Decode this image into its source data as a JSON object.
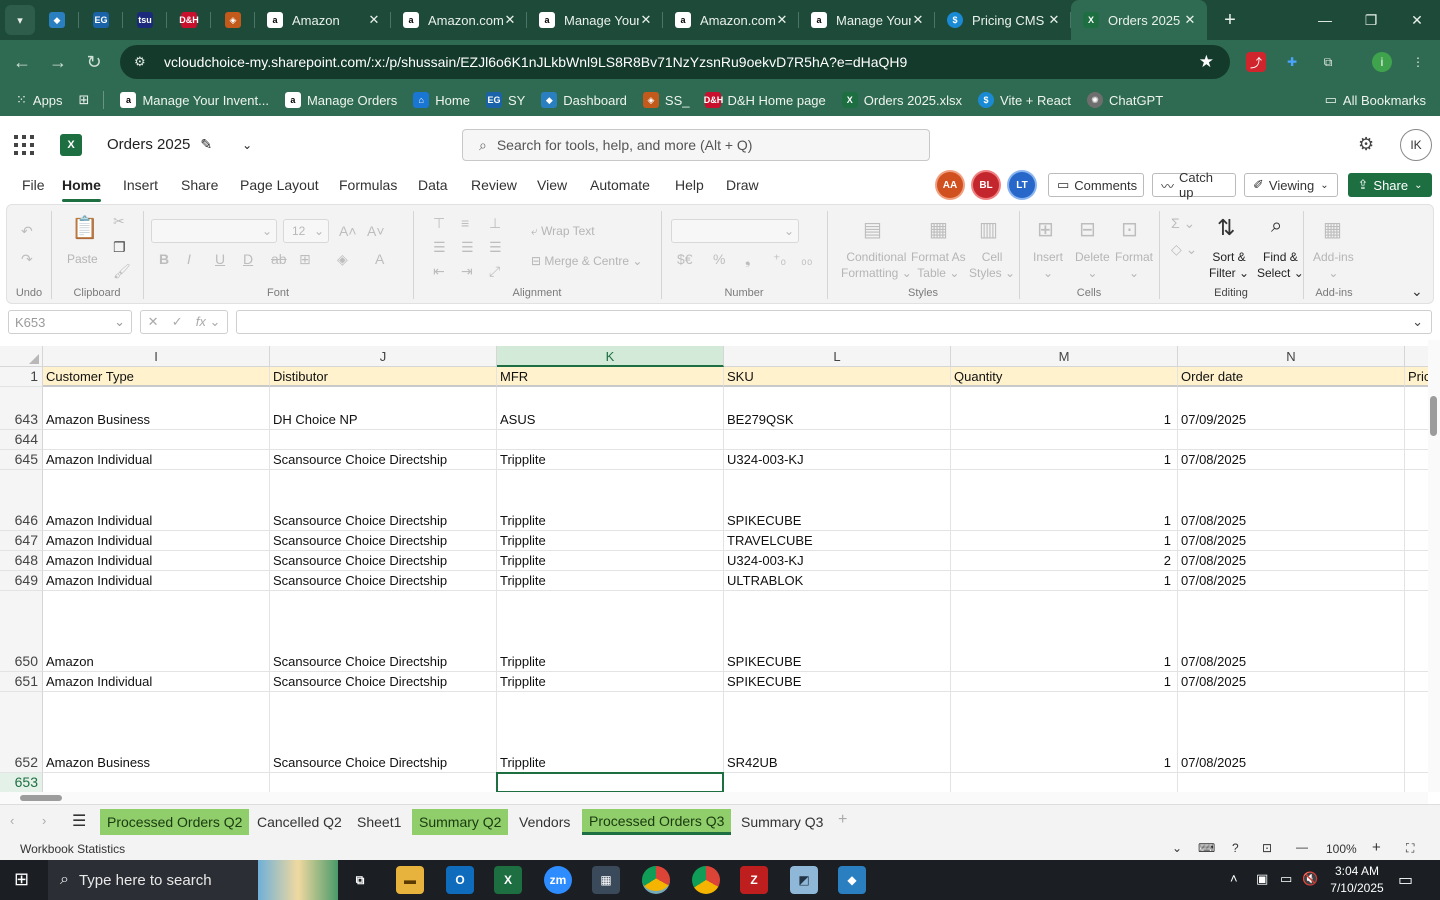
{
  "browser": {
    "tabs": [
      {
        "label": "Amazon",
        "icon": "amazon-icon"
      },
      {
        "label": "Amazon.com",
        "icon": "amazon-icon"
      },
      {
        "label": "Manage Your",
        "icon": "amazon-icon"
      },
      {
        "label": "Amazon.com",
        "icon": "amazon-icon"
      },
      {
        "label": "Manage Your",
        "icon": "amazon-icon"
      },
      {
        "label": "Pricing CMS",
        "icon": "dollar-icon"
      },
      {
        "label": "Orders 2025",
        "icon": "excel-icon",
        "active": true
      }
    ],
    "pinned_icons": [
      "vite-icon",
      "eg-icon",
      "tsu-icon",
      "dh-icon",
      "ssl-icon"
    ],
    "url": "vcloudchoice-my.sharepoint.com/:x:/p/shussain/EZJl6o6K1nJLkbWnl9LS8R8Bv71NzYzsnRu9oekvD7R5hA?e=dHaQH9",
    "bookmarks": [
      {
        "label": "Apps"
      },
      {
        "label": "Manage Your Invent..."
      },
      {
        "label": "Manage Orders"
      },
      {
        "label": "Home"
      },
      {
        "label": "SY"
      },
      {
        "label": "Dashboard"
      },
      {
        "label": "SS_"
      },
      {
        "label": "D&H Home page"
      },
      {
        "label": "Orders 2025.xlsx"
      },
      {
        "label": "Vite + React"
      },
      {
        "label": "ChatGPT"
      }
    ],
    "all_bookmarks": "All Bookmarks"
  },
  "excel": {
    "doc_title": "Orders 2025",
    "search_placeholder": "Search for tools, help, and more (Alt + Q)",
    "avatar": "IK",
    "menu": [
      "File",
      "Home",
      "Insert",
      "Share",
      "Page Layout",
      "Formulas",
      "Data",
      "Review",
      "View",
      "Automate",
      "Help",
      "Draw"
    ],
    "presence": [
      {
        "initials": "AA",
        "color": "#d0501f"
      },
      {
        "initials": "BL",
        "color": "#c4262e"
      },
      {
        "initials": "LT",
        "color": "#2767c9"
      }
    ],
    "comments": "Comments",
    "catch_up": "Catch up",
    "viewing": "Viewing",
    "share": "Share",
    "ribbon": {
      "undo": "Undo",
      "paste": "Paste",
      "clipboard": "Clipboard",
      "font_size": "12",
      "font": "Font",
      "wrap_text": "Wrap Text",
      "merge_centre": "Merge & Centre",
      "alignment": "Alignment",
      "number": "Number",
      "conditional": "Conditional",
      "formatting": "Formatting",
      "format_as": "Format As",
      "table": "Table",
      "cell": "Cell",
      "styles_btn": "Styles",
      "styles": "Styles",
      "insert": "Insert",
      "delete": "Delete",
      "format": "Format",
      "cells": "Cells",
      "sort": "Sort &",
      "filter": "Filter",
      "find": "Find &",
      "select": "Select",
      "editing": "Editing",
      "addins": "Add-ins",
      "addins_group": "Add-ins"
    },
    "name_box": "K653",
    "columns": [
      {
        "letter": "I",
        "header": "Customer Type"
      },
      {
        "letter": "J",
        "header": "Distibutor"
      },
      {
        "letter": "K",
        "header": "MFR"
      },
      {
        "letter": "L",
        "header": "SKU"
      },
      {
        "letter": "M",
        "header": "Quantity"
      },
      {
        "letter": "N",
        "header": "Order date"
      },
      {
        "letter": "",
        "header": "Pric"
      }
    ],
    "rows": [
      {
        "num": "643",
        "cells": [
          "Amazon Business",
          "DH Choice NP",
          "ASUS",
          "BE279QSK",
          "1",
          "07/09/2025"
        ]
      },
      {
        "num": "644",
        "cells": [
          "",
          "",
          "",
          "",
          "",
          ""
        ]
      },
      {
        "num": "645",
        "cells": [
          "Amazon Individual",
          "Scansource Choice Directship",
          "Tripplite",
          "U324-003-KJ",
          "1",
          "07/08/2025"
        ]
      },
      {
        "num": "646",
        "cells": [
          "Amazon Individual",
          "Scansource Choice Directship",
          "Tripplite",
          "SPIKECUBE",
          "1",
          "07/08/2025"
        ]
      },
      {
        "num": "647",
        "cells": [
          "Amazon Individual",
          "Scansource Choice Directship",
          "Tripplite",
          "TRAVELCUBE",
          "1",
          "07/08/2025"
        ]
      },
      {
        "num": "648",
        "cells": [
          "Amazon Individual",
          "Scansource Choice Directship",
          "Tripplite",
          "U324-003-KJ",
          "2",
          "07/08/2025"
        ]
      },
      {
        "num": "649",
        "cells": [
          "Amazon Individual",
          "Scansource Choice Directship",
          "Tripplite",
          "ULTRABLOK",
          "1",
          "07/08/2025"
        ]
      },
      {
        "num": "650",
        "cells": [
          "Amazon",
          "Scansource Choice Directship",
          "Tripplite",
          "SPIKECUBE",
          "1",
          "07/08/2025"
        ]
      },
      {
        "num": "651",
        "cells": [
          "Amazon Individual",
          "Scansource Choice Directship",
          "Tripplite",
          "SPIKECUBE",
          "1",
          "07/08/2025"
        ]
      },
      {
        "num": "652",
        "cells": [
          "Amazon Business",
          "Scansource Choice Directship",
          "Tripplite",
          "SR42UB",
          "1",
          "07/08/2025"
        ]
      },
      {
        "num": "653",
        "cells": [
          "",
          "",
          "",
          "",
          "",
          ""
        ]
      }
    ],
    "sheets": [
      {
        "label": "Processed Orders Q2",
        "green": true
      },
      {
        "label": "Cancelled Q2",
        "green": false
      },
      {
        "label": "Sheet1",
        "green": false
      },
      {
        "label": "Summary Q2",
        "green": true
      },
      {
        "label": "Vendors",
        "green": false
      },
      {
        "label": "Processed Orders Q3",
        "green": true,
        "active": true
      },
      {
        "label": "Summary Q3",
        "green": false
      }
    ],
    "status_left": "Workbook Statistics",
    "zoom": "100%"
  },
  "taskbar": {
    "search_placeholder": "Type here to search",
    "time": "3:04 AM",
    "date": "7/10/2025"
  },
  "colors": {
    "excel_green": "#1d6f42",
    "header_fill": "#fff2cc",
    "tab_green": "#8fce6a"
  }
}
